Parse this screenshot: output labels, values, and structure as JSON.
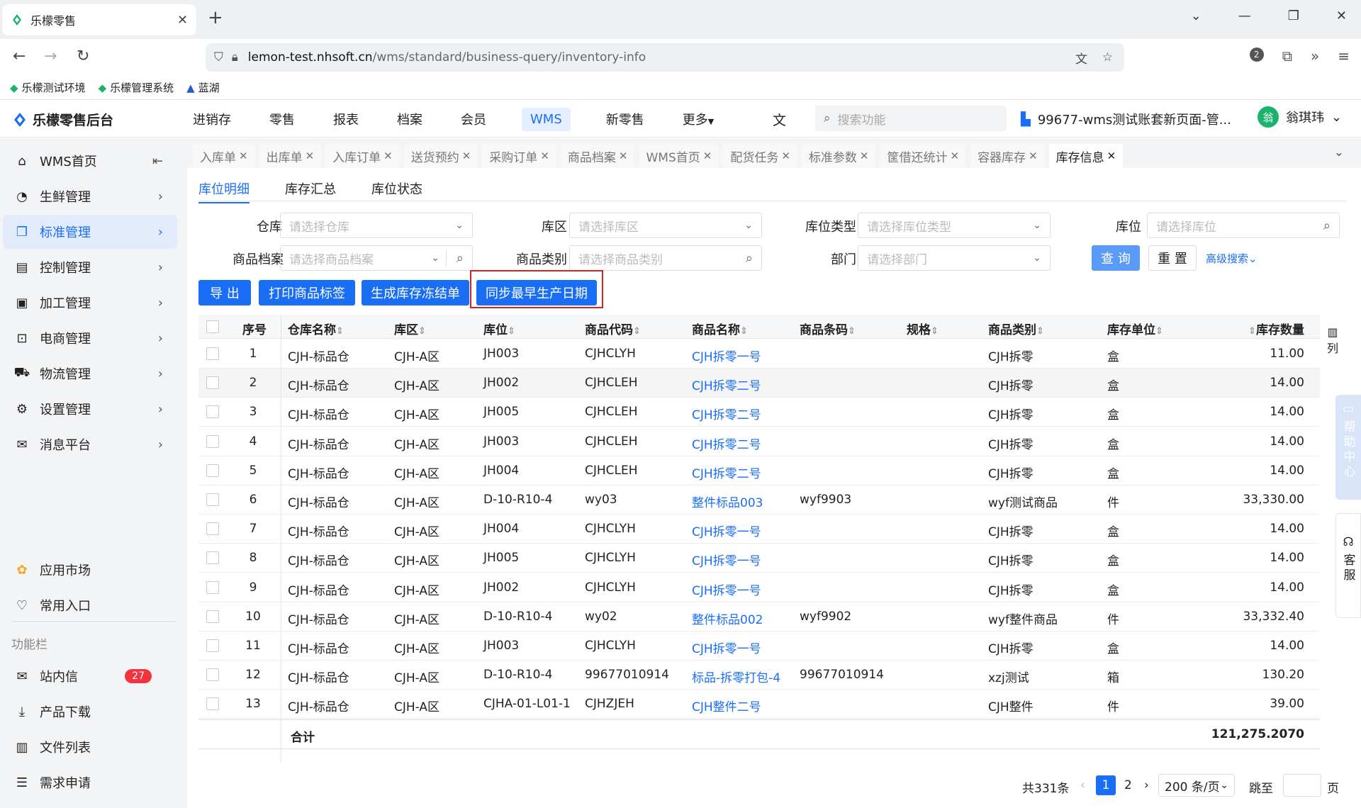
{
  "browser": {
    "tab_title": "乐檬零售",
    "url_host": "lemon-test.nhsoft.cn",
    "url_path": "/wms/standard/business-query/inventory-info",
    "badge_count": "2",
    "bookmarks": [
      "乐檬测试环境",
      "乐檬管理系统",
      "蓝湖"
    ]
  },
  "header": {
    "logo": "乐檬零售后台",
    "nav": [
      "进销存",
      "零售",
      "报表",
      "档案",
      "会员",
      "WMS",
      "新零售",
      "更多"
    ],
    "active_nav": "WMS",
    "search_placeholder": "搜索功能",
    "tenant": "99677-wms测试账套新页面-管...",
    "avatar_text": "翁",
    "username": "翁琪玮"
  },
  "sidebar": {
    "items": [
      {
        "label": "WMS首页",
        "icon": "home-icon"
      },
      {
        "label": "生鲜管理",
        "icon": "fresh-icon"
      },
      {
        "label": "标准管理",
        "icon": "standard-icon"
      },
      {
        "label": "控制管理",
        "icon": "control-icon"
      },
      {
        "label": "加工管理",
        "icon": "process-icon"
      },
      {
        "label": "电商管理",
        "icon": "ecommerce-icon"
      },
      {
        "label": "物流管理",
        "icon": "truck-icon"
      },
      {
        "label": "设置管理",
        "icon": "settings-icon"
      },
      {
        "label": "消息平台",
        "icon": "message-icon"
      }
    ],
    "bottom": [
      {
        "label": "应用市场"
      },
      {
        "label": "常用入口"
      }
    ],
    "section_title": "功能栏",
    "tools": [
      {
        "label": "站内信",
        "badge": "27"
      },
      {
        "label": "产品下载"
      },
      {
        "label": "文件列表"
      },
      {
        "label": "需求申请"
      }
    ]
  },
  "page_tabs": [
    "入库单",
    "出库单",
    "入库订单",
    "送货预约",
    "采购订单",
    "商品档案",
    "WMS首页",
    "配货任务",
    "标准参数",
    "筐借还统计",
    "容器库存",
    "库存信息"
  ],
  "active_page_tab": "库存信息",
  "sub_tabs": [
    "库位明细",
    "库存汇总",
    "库位状态"
  ],
  "filters": {
    "warehouse": {
      "label": "仓库",
      "placeholder": "请选择仓库"
    },
    "zone": {
      "label": "库区",
      "placeholder": "请选择库区"
    },
    "location_type": {
      "label": "库位类型",
      "placeholder": "请选择库位类型"
    },
    "location": {
      "label": "库位",
      "placeholder": "请选择库位"
    },
    "product": {
      "label": "商品档案",
      "placeholder": "请选择商品档案"
    },
    "category": {
      "label": "商品类别",
      "placeholder": "请选择商品类别"
    },
    "dept": {
      "label": "部门",
      "placeholder": "请选择部门"
    }
  },
  "actions": {
    "query": "查 询",
    "reset": "重 置",
    "advanced": "高级搜索",
    "export": "导 出",
    "print": "打印商品标签",
    "freeze": "生成库存冻结单",
    "sync": "同步最早生产日期"
  },
  "table": {
    "headers": [
      "序号",
      "仓库名称",
      "库区",
      "库位",
      "商品代码",
      "商品名称",
      "商品条码",
      "规格",
      "商品类别",
      "库存单位",
      "库存数量"
    ],
    "rows": [
      [
        "1",
        "CJH-标品仓",
        "CJH-A区",
        "JH003",
        "CJHCLYH",
        "CJH拆零一号",
        "",
        "",
        "CJH拆零",
        "盒",
        "11.00"
      ],
      [
        "2",
        "CJH-标品仓",
        "CJH-A区",
        "JH002",
        "CJHCLEH",
        "CJH拆零二号",
        "",
        "",
        "CJH拆零",
        "盒",
        "14.00"
      ],
      [
        "3",
        "CJH-标品仓",
        "CJH-A区",
        "JH005",
        "CJHCLEH",
        "CJH拆零二号",
        "",
        "",
        "CJH拆零",
        "盒",
        "14.00"
      ],
      [
        "4",
        "CJH-标品仓",
        "CJH-A区",
        "JH003",
        "CJHCLEH",
        "CJH拆零二号",
        "",
        "",
        "CJH拆零",
        "盒",
        "14.00"
      ],
      [
        "5",
        "CJH-标品仓",
        "CJH-A区",
        "JH004",
        "CJHCLEH",
        "CJH拆零二号",
        "",
        "",
        "CJH拆零",
        "盒",
        "14.00"
      ],
      [
        "6",
        "CJH-标品仓",
        "CJH-A区",
        "D-10-R10-4",
        "wy03",
        "整件标品003",
        "wyf9903",
        "",
        "wyf测试商品",
        "件",
        "33,330.00"
      ],
      [
        "7",
        "CJH-标品仓",
        "CJH-A区",
        "JH004",
        "CJHCLYH",
        "CJH拆零一号",
        "",
        "",
        "CJH拆零",
        "盒",
        "14.00"
      ],
      [
        "8",
        "CJH-标品仓",
        "CJH-A区",
        "JH005",
        "CJHCLYH",
        "CJH拆零一号",
        "",
        "",
        "CJH拆零",
        "盒",
        "14.00"
      ],
      [
        "9",
        "CJH-标品仓",
        "CJH-A区",
        "JH002",
        "CJHCLYH",
        "CJH拆零一号",
        "",
        "",
        "CJH拆零",
        "盒",
        "14.00"
      ],
      [
        "10",
        "CJH-标品仓",
        "CJH-A区",
        "D-10-R10-4",
        "wy02",
        "整件标品002",
        "wyf9902",
        "",
        "wyf整件商品",
        "件",
        "33,332.40"
      ],
      [
        "11",
        "CJH-标品仓",
        "CJH-A区",
        "JH003",
        "CJHCLYH",
        "CJH拆零一号",
        "",
        "",
        "CJH拆零",
        "盒",
        "14.00"
      ],
      [
        "12",
        "CJH-标品仓",
        "CJH-A区",
        "D-10-R10-4",
        "99677010914",
        "标品-拆零打包-4",
        "99677010914",
        "",
        "xzj测试",
        "箱",
        "130.20"
      ],
      [
        "13",
        "CJH-标品仓",
        "CJH-A区",
        "CJHA-01-L01-1",
        "CJHZJEH",
        "CJH整件二号",
        "",
        "",
        "CJH整件",
        "件",
        "39.00"
      ]
    ],
    "total_label": "合计",
    "total_value": "121,275.2070",
    "column_setting": "列"
  },
  "pager": {
    "total": "共331条",
    "pages": [
      "1",
      "2"
    ],
    "page_size": "200 条/页",
    "jump_label": "跳至",
    "page_unit": "页"
  },
  "floaters": {
    "help": "帮助中心",
    "service": "客服"
  },
  "colors": {
    "primary": "#1a6ef5",
    "danger": "#e02020",
    "badge": "#f5333f"
  }
}
